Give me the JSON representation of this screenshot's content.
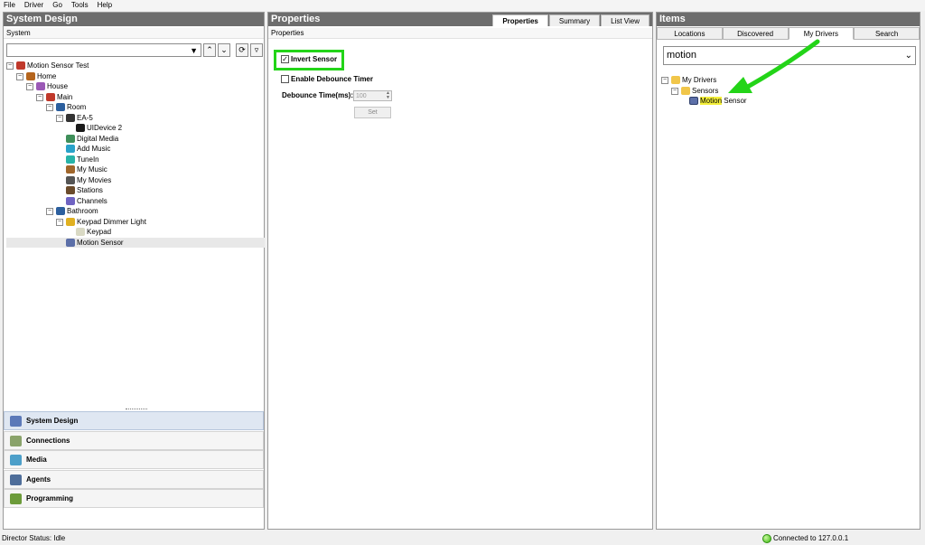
{
  "menubar": [
    "File",
    "Driver",
    "Go",
    "Tools",
    "Help"
  ],
  "left": {
    "title": "System Design",
    "subheader": "System",
    "combo_value": "",
    "tree": [
      {
        "label": "Motion Sensor Test",
        "depth": 0,
        "exp": "minus",
        "icon": "project-icon",
        "color": "#c0392b"
      },
      {
        "label": "Home",
        "depth": 1,
        "exp": "minus",
        "icon": "home-icon",
        "color": "#b5651d"
      },
      {
        "label": "House",
        "depth": 2,
        "exp": "minus",
        "icon": "house-icon",
        "color": "#9b59b6"
      },
      {
        "label": "Main",
        "depth": 3,
        "exp": "minus",
        "icon": "floor-icon",
        "color": "#c0392b"
      },
      {
        "label": "Room",
        "depth": 4,
        "exp": "minus",
        "icon": "room-icon",
        "color": "#2c5f9e"
      },
      {
        "label": "EA-5",
        "depth": 5,
        "exp": "minus",
        "icon": "controller-icon",
        "color": "#333333"
      },
      {
        "label": "UIDevice 2",
        "depth": 6,
        "exp": "",
        "icon": "ui-device-icon",
        "color": "#1a1a1a"
      },
      {
        "label": "Digital Media",
        "depth": 5,
        "exp": "",
        "icon": "digital-media-icon",
        "color": "#3f8f5a"
      },
      {
        "label": "Add Music",
        "depth": 5,
        "exp": "",
        "icon": "add-music-icon",
        "color": "#29a2c9"
      },
      {
        "label": "TuneIn",
        "depth": 5,
        "exp": "",
        "icon": "tunein-icon",
        "color": "#27b3a8"
      },
      {
        "label": "My Music",
        "depth": 5,
        "exp": "",
        "icon": "music-icon",
        "color": "#a0662b"
      },
      {
        "label": "My Movies",
        "depth": 5,
        "exp": "",
        "icon": "movies-icon",
        "color": "#555555"
      },
      {
        "label": "Stations",
        "depth": 5,
        "exp": "",
        "icon": "stations-icon",
        "color": "#6b4b2b"
      },
      {
        "label": "Channels",
        "depth": 5,
        "exp": "",
        "icon": "channels-icon",
        "color": "#6f63c2"
      },
      {
        "label": "Bathroom",
        "depth": 4,
        "exp": "minus",
        "icon": "room-icon",
        "color": "#2c5f9e"
      },
      {
        "label": "Keypad Dimmer Light",
        "depth": 5,
        "exp": "minus",
        "icon": "keypad-dimmer-icon",
        "color": "#e0b020"
      },
      {
        "label": "Keypad",
        "depth": 6,
        "exp": "",
        "icon": "keypad-icon",
        "color": "#d9d9c4"
      },
      {
        "label": "Motion Sensor",
        "depth": 5,
        "exp": "",
        "icon": "motion-sensor-icon",
        "color": "#5c6fa8",
        "selected": true
      }
    ],
    "nav": [
      {
        "label": "System Design",
        "icon": "system-design-icon",
        "color": "#5c79b8",
        "active": true
      },
      {
        "label": "Connections",
        "icon": "connections-icon",
        "color": "#8aa36b"
      },
      {
        "label": "Media",
        "icon": "media-icon",
        "color": "#4d9fc9"
      },
      {
        "label": "Agents",
        "icon": "agents-icon",
        "color": "#4f6e9a"
      },
      {
        "label": "Programming",
        "icon": "programming-icon",
        "color": "#6c9b3a"
      }
    ]
  },
  "middle": {
    "title": "Properties",
    "tabs": [
      "Properties",
      "Summary",
      "List View"
    ],
    "subheader": "Properties",
    "invert_sensor": "Invert Sensor",
    "enable_debounce": "Enable Debounce Timer",
    "debounce_label": "Debounce Time(ms):",
    "debounce_value": "100",
    "set_label": "Set"
  },
  "right": {
    "title": "Items",
    "tabs": [
      "Locations",
      "Discovered",
      "My Drivers",
      "Search"
    ],
    "search_value": "motion",
    "tree": [
      {
        "label": "My Drivers"
      },
      {
        "label": "Sensors"
      },
      {
        "highlight": "Motion",
        "rest": " Sensor"
      }
    ]
  },
  "status": {
    "left": "Director Status: Idle",
    "right": "Connected to 127.0.0.1"
  },
  "colors": {
    "header_bg": "#6d6d6d",
    "callout_green": "#23d418"
  }
}
